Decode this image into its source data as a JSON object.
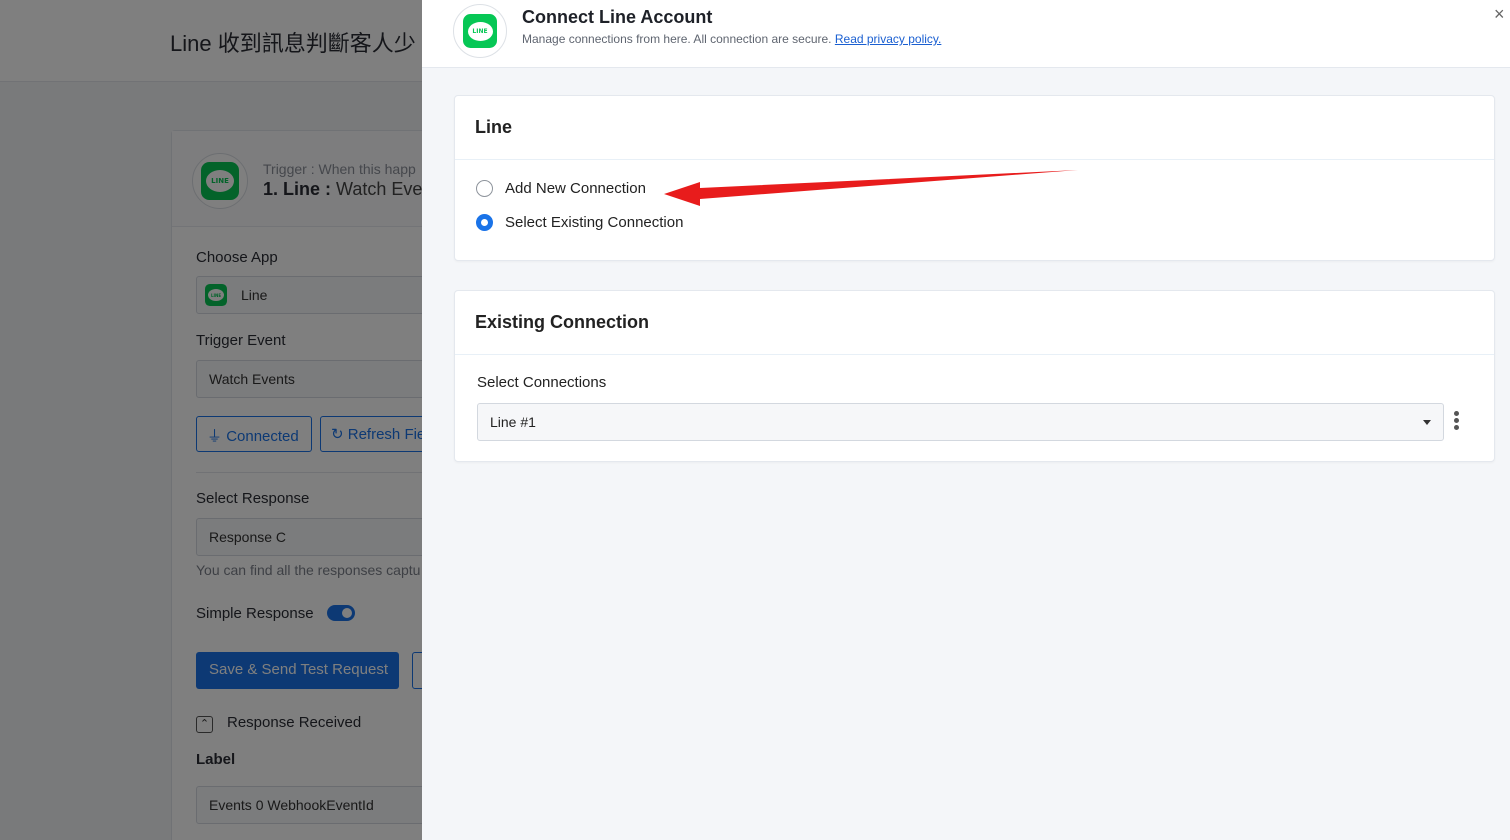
{
  "background": {
    "page_title": "Line 收到訊息判斷客人少",
    "trigger": {
      "subtitle": "Trigger : When this happ",
      "step_label": "1. Line :",
      "event_label": "Watch Event"
    },
    "choose_app_label": "Choose App",
    "choose_app_value": "Line",
    "trigger_event_label": "Trigger Event",
    "trigger_event_value": "Watch Events",
    "connected_button": "Connected",
    "refresh_button": "Refresh Fie",
    "select_response_label": "Select Response",
    "select_response_value": "Response C",
    "responses_hint": "You can find all the responses captu",
    "simple_response_label": "Simple Response",
    "save_test_button": "Save & Send Test Request",
    "response_received_label": "Response Received",
    "label_heading": "Label",
    "label_value": "Events 0 WebhookEventId"
  },
  "drawer": {
    "title": "Connect Line Account",
    "subtitle": "Manage connections from here. All connection are secure.",
    "privacy_link": "Read privacy policy.",
    "close_symbol": "×",
    "logo_text": "LINE"
  },
  "line_panel": {
    "heading": "Line",
    "options": [
      {
        "label": "Add New Connection",
        "selected": false
      },
      {
        "label": "Select Existing Connection",
        "selected": true
      }
    ]
  },
  "existing_panel": {
    "heading": "Existing Connection",
    "select_label": "Select Connections",
    "selected_value": "Line #1"
  },
  "colors": {
    "accent": "#1a73e8",
    "line_green": "#06c755",
    "annotation_arrow": "#e81c1c"
  },
  "icons": [
    "line-logo-icon",
    "plug-icon",
    "refresh-icon",
    "chevron-up-icon",
    "close-icon",
    "caret-down-icon",
    "kebab-menu-icon"
  ]
}
